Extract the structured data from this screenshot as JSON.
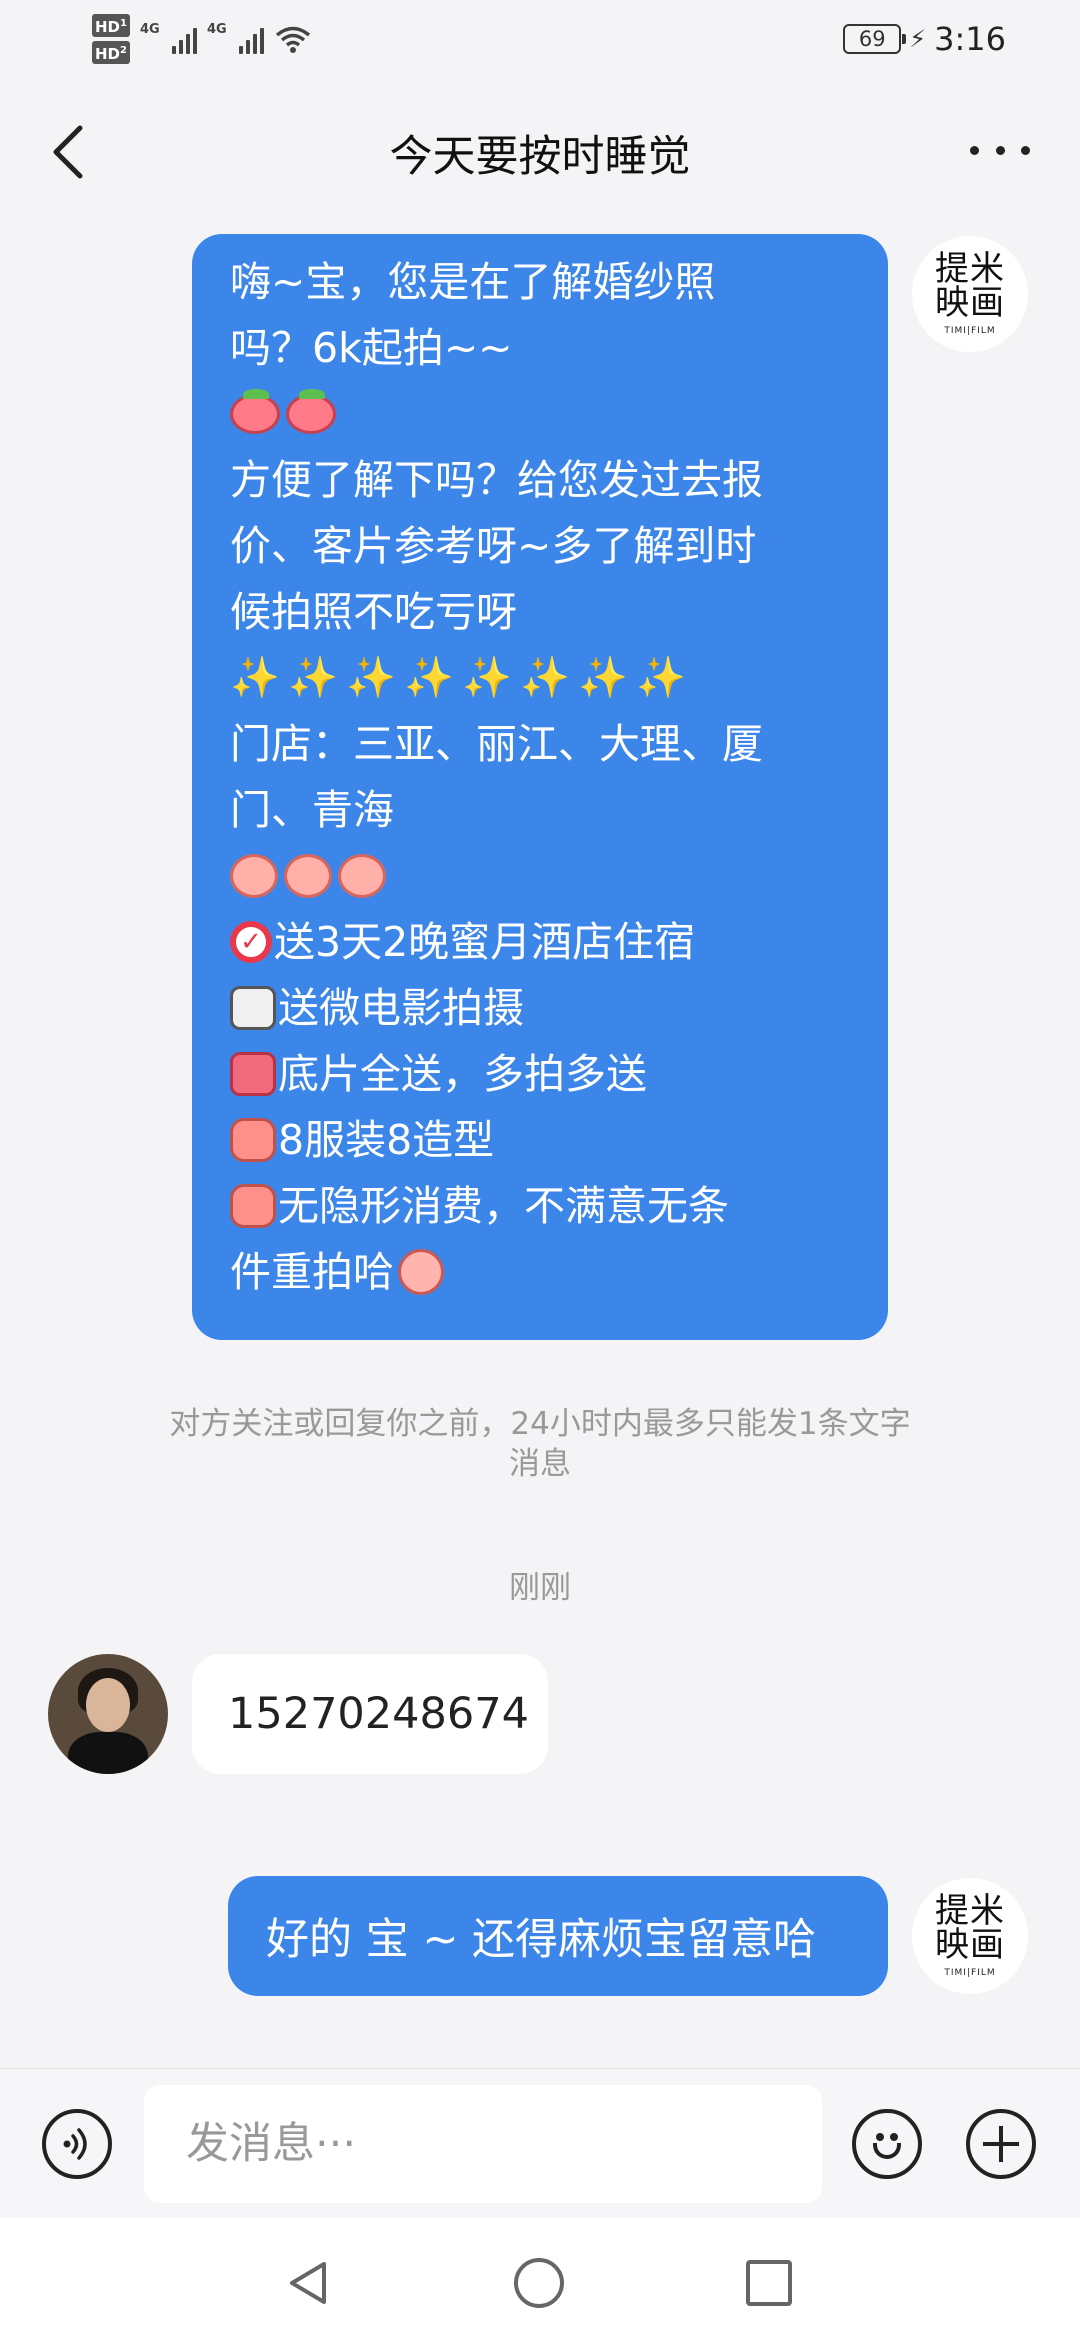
{
  "status_bar": {
    "hd1": "HD",
    "hd1_sub": "1",
    "hd2": "HD",
    "hd2_sub": "2",
    "net1": "4G",
    "net2": "4G",
    "battery": "69",
    "time": "3:16"
  },
  "nav": {
    "title": "今天要按时睡觉"
  },
  "brand_logo": {
    "text": "提米映画",
    "sub": "TIMI|FILM"
  },
  "messages": {
    "promo": {
      "l1": "嗨~宝，您是在了解婚纱照",
      "l2": "吗？6k起拍~~",
      "l3": "方便了解下吗？给您发过去报",
      "l4": "价、客片参考呀~多了解到时",
      "l5": "候拍照不吃亏呀",
      "l6": "门店：三亚、丽江、大理、厦",
      "l7": "门、青海",
      "l8": "送3天2晚蜜月酒店住宿",
      "l9": "送微电影拍摄",
      "l10": "底片全送，多拍多送",
      "l11": "8服装8造型",
      "l12": "无隐形消费，不满意无条",
      "l13": "件重拍哈"
    },
    "notice_l1": "对方关注或回复你之前，24小时内最多只能发1条文字",
    "notice_l2": "消息",
    "timestamp": "刚刚",
    "incoming": "15270248674",
    "reply": "好的 宝 ~ 还得麻烦宝留意哈"
  },
  "input": {
    "placeholder": "发消息···"
  },
  "colors": {
    "bubble_blue": "#3c86ea",
    "background": "#f4f4f6"
  },
  "icons": [
    "back-arrow-icon",
    "more-icon",
    "voice-icon",
    "emoji-icon",
    "plus-icon",
    "wifi-icon",
    "battery-icon"
  ]
}
